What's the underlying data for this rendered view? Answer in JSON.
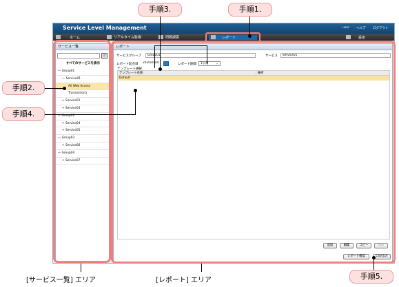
{
  "app": {
    "title": "Service Level Management",
    "menu_right": [
      "user",
      "ヘルプ",
      "ログアウト"
    ]
  },
  "nav": {
    "items": [
      "ホーム",
      "リアルタイム監視",
      "問題調査",
      "レポート",
      "設定"
    ],
    "active": "レポート"
  },
  "left_panel": {
    "title": "サービス一覧",
    "search_placeholder": "",
    "show_all_label": "すべてのサービスを表示",
    "tree": [
      "— Group01",
      "— Service01",
      "All Web Access",
      "Transaction1",
      "+ Service02",
      "+ Service03",
      "— Group02",
      "+ Service04",
      "+ Service05",
      "— Group03",
      "+ Service06",
      "— Group04",
      "+ Service07"
    ],
    "selected_item": "All Web Access"
  },
  "report_panel": {
    "title": "レポート",
    "service_group_label": "サービスグループ",
    "service_group_value": "Group01",
    "service_label": "サービス",
    "service_value": "Service01",
    "start_date_label": "レポート起点日",
    "start_date_value": "2020/01/01",
    "period_label": "レポート期間",
    "period_value": "1ヶ月",
    "template_section_label": "テンプレート選択",
    "table": {
      "columns": [
        "テンプレート名称",
        "備考"
      ],
      "rows": [
        [
          "Default",
          ""
        ]
      ]
    },
    "buttons": {
      "add": "追加",
      "edit": "編集",
      "copy": "コピー",
      "delete": "削除",
      "confirm": "レポート確認",
      "csv": "CSV出力"
    }
  },
  "annotations": {
    "step1": "手順1.",
    "step2": "手順2.",
    "step3": "手順3.",
    "step4": "手順4.",
    "step5": "手順5.",
    "area_left": "[サービス一覧] エリア",
    "area_right": "[レポート] エリア"
  },
  "colors": {
    "highlight": "#f08080",
    "selected_row": "#fbe6a3",
    "titlebar": "#1f5f95",
    "callout_bg": "#fde0e0"
  }
}
